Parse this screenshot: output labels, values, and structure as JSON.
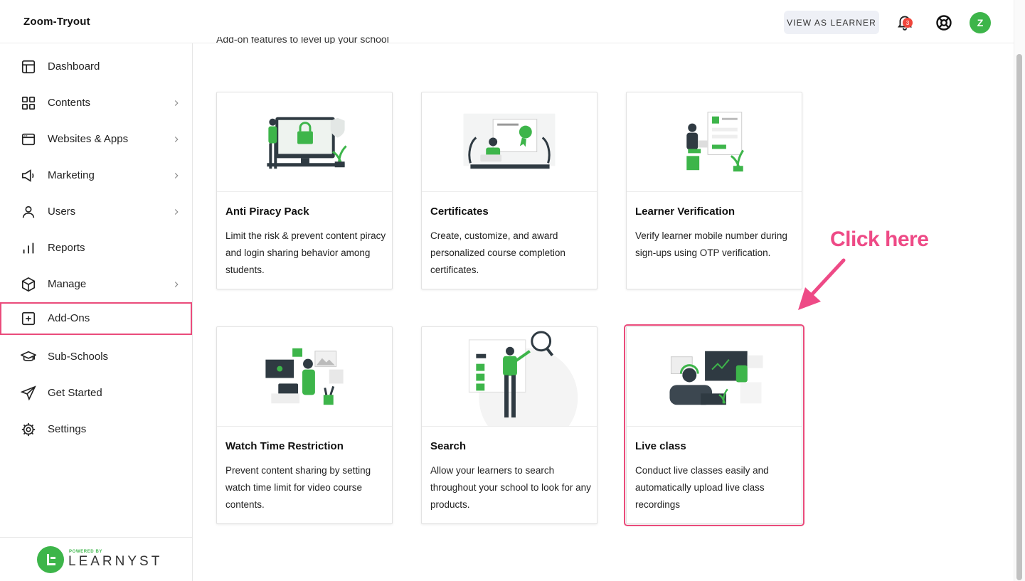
{
  "header": {
    "school_name": "Zoom-Tryout",
    "view_as_learner": "VIEW AS LEARNER",
    "notification_count": "3",
    "avatar_initial": "Z"
  },
  "sidebar": {
    "items": [
      {
        "label": "Dashboard",
        "icon": "layout-icon",
        "chevron": false
      },
      {
        "label": "Contents",
        "icon": "grid-icon",
        "chevron": true
      },
      {
        "label": "Websites & Apps",
        "icon": "browser-window-icon",
        "chevron": true
      },
      {
        "label": "Marketing",
        "icon": "megaphone-icon",
        "chevron": true
      },
      {
        "label": "Users",
        "icon": "user-icon",
        "chevron": true
      },
      {
        "label": "Reports",
        "icon": "bar-chart-icon",
        "chevron": false
      },
      {
        "label": "Manage",
        "icon": "box-icon",
        "chevron": true
      },
      {
        "label": "Add-Ons",
        "icon": "plus-square-icon",
        "chevron": false,
        "active": true
      },
      {
        "label": "Sub-Schools",
        "icon": "graduation-cap-icon",
        "chevron": false
      },
      {
        "label": "Get Started",
        "icon": "send-icon",
        "chevron": false
      },
      {
        "label": "Settings",
        "icon": "gear-icon",
        "chevron": false
      }
    ],
    "footer": {
      "powered_by": "POWERED BY",
      "brand": "LEARNYST"
    }
  },
  "main": {
    "subtitle": "Add-on features to level up your school",
    "cards": [
      {
        "title": "Anti Piracy Pack",
        "description": "Limit the risk & prevent content piracy and login sharing behavior among students."
      },
      {
        "title": "Certificates",
        "description": "Create, customize, and award personalized course completion certificates."
      },
      {
        "title": "Learner Verification",
        "description": "Verify learner mobile number during sign-ups using OTP verification."
      },
      {
        "title": "Watch Time Restriction",
        "description": "Prevent content sharing by setting watch time limit for video course contents."
      },
      {
        "title": "Search",
        "description": "Allow your learners to search throughout your school to look for any products."
      },
      {
        "title": "Live class",
        "description": "Conduct live classes easily and automatically upload live class recordings"
      }
    ],
    "annotation": "Click here"
  },
  "colors": {
    "accent": "#3db54a",
    "highlight": "#ea4b7b",
    "badge": "#f0453a"
  }
}
